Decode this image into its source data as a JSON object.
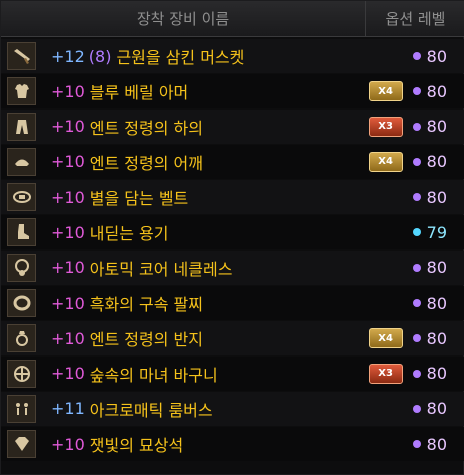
{
  "header": {
    "name_label": "장착 장비 이름",
    "level_label": "옵션 레벨"
  },
  "colors": {
    "accent_purple": "#b07cff",
    "accent_blue": "#54d7ff",
    "item_gold": "#f5c21b"
  },
  "items": [
    {
      "enh": "+12",
      "paren": "(8)",
      "name": "근원을 삼킨 머스켓",
      "badge": "",
      "level": "80",
      "dot": "purple",
      "icon": "musket-icon"
    },
    {
      "enh": "+10",
      "paren": "",
      "name": "블루 베릴 아머",
      "badge": "X4",
      "level": "80",
      "dot": "purple",
      "icon": "armor-icon"
    },
    {
      "enh": "+10",
      "paren": "",
      "name": "엔트 정령의 하의",
      "badge": "X3",
      "level": "80",
      "dot": "purple",
      "icon": "pants-icon"
    },
    {
      "enh": "+10",
      "paren": "",
      "name": "엔트 정령의 어깨",
      "badge": "X4",
      "level": "80",
      "dot": "purple",
      "icon": "shoulder-icon"
    },
    {
      "enh": "+10",
      "paren": "",
      "name": "별을 담는 벨트",
      "badge": "",
      "level": "80",
      "dot": "purple",
      "icon": "belt-icon"
    },
    {
      "enh": "+10",
      "paren": "",
      "name": "내딛는 용기",
      "badge": "",
      "level": "79",
      "dot": "blue",
      "icon": "boots-icon"
    },
    {
      "enh": "+10",
      "paren": "",
      "name": "아토믹 코어 네클레스",
      "badge": "",
      "level": "80",
      "dot": "purple",
      "icon": "necklace-icon"
    },
    {
      "enh": "+10",
      "paren": "",
      "name": "흑화의 구속 팔찌",
      "badge": "",
      "level": "80",
      "dot": "purple",
      "icon": "bracelet-icon"
    },
    {
      "enh": "+10",
      "paren": "",
      "name": "엔트 정령의 반지",
      "badge": "X4",
      "level": "80",
      "dot": "purple",
      "icon": "ring-icon"
    },
    {
      "enh": "+10",
      "paren": "",
      "name": "숲속의 마녀 바구니",
      "badge": "X3",
      "level": "80",
      "dot": "purple",
      "icon": "basket-icon"
    },
    {
      "enh": "+11",
      "paren": "",
      "name": "아크로매틱 룸버스",
      "badge": "",
      "level": "80",
      "dot": "purple",
      "icon": "earring-icon"
    },
    {
      "enh": "+10",
      "paren": "",
      "name": "잿빛의 묘상석",
      "badge": "",
      "level": "80",
      "dot": "purple",
      "icon": "gem-icon"
    }
  ]
}
